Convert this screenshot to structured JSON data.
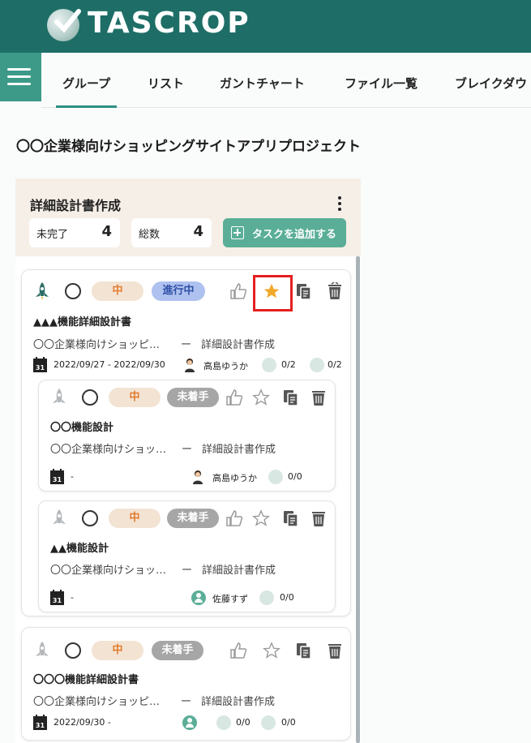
{
  "app": {
    "name": "TASCROP"
  },
  "nav": {
    "tabs": [
      {
        "label": "グループ",
        "active": true
      },
      {
        "label": "リスト"
      },
      {
        "label": "ガントチャート"
      },
      {
        "label": "ファイル一覧"
      },
      {
        "label": "ブレイクダウ"
      }
    ]
  },
  "project": {
    "title": "〇〇企業様向けショッピングサイトアプリプロジェクト"
  },
  "group": {
    "title": "詳細設計書作成",
    "stats": {
      "incomplete_label": "未完了",
      "incomplete_count": "4",
      "total_label": "総数",
      "total_count": "4"
    },
    "add_task_label": "タスクを追加する"
  },
  "tasks": [
    {
      "priority": "中",
      "status": "進行中",
      "name": "▲▲▲機能詳細設計書",
      "project_short": "〇〇企業様向けショッピ…",
      "sep": "ー",
      "group": "詳細設計書作成",
      "dates": "2022/09/27 - 2022/09/30",
      "assignee": "高島ゆうか",
      "subtasks": "0/2",
      "checks": "0/2",
      "starred": true
    },
    {
      "priority": "中",
      "status": "未着手",
      "name": "〇〇機能設計",
      "project_short": "〇〇企業様向けショッ…",
      "sep": "ー",
      "group": "詳細設計書作成",
      "dates": "-",
      "assignee": "高島ゆうか",
      "checks": "0/0"
    },
    {
      "priority": "中",
      "status": "未着手",
      "name": "▲▲機能設計",
      "project_short": "〇〇企業様向けショッ…",
      "sep": "ー",
      "group": "詳細設計書作成",
      "dates": "-",
      "assignee": "佐藤すず",
      "checks": "0/0"
    },
    {
      "priority": "中",
      "status": "未着手",
      "name": "〇〇〇機能詳細設計書",
      "project_short": "〇〇企業様向けショッピ…",
      "sep": "ー",
      "group": "詳細設計書作成",
      "dates": "2022/09/30 -",
      "subtasks": "0/0",
      "checks": "0/0"
    }
  ],
  "colors": {
    "header": "#1e6e67",
    "accent": "#5aae97",
    "highlight": "#e51f1f",
    "star_active": "#f0a92a"
  }
}
